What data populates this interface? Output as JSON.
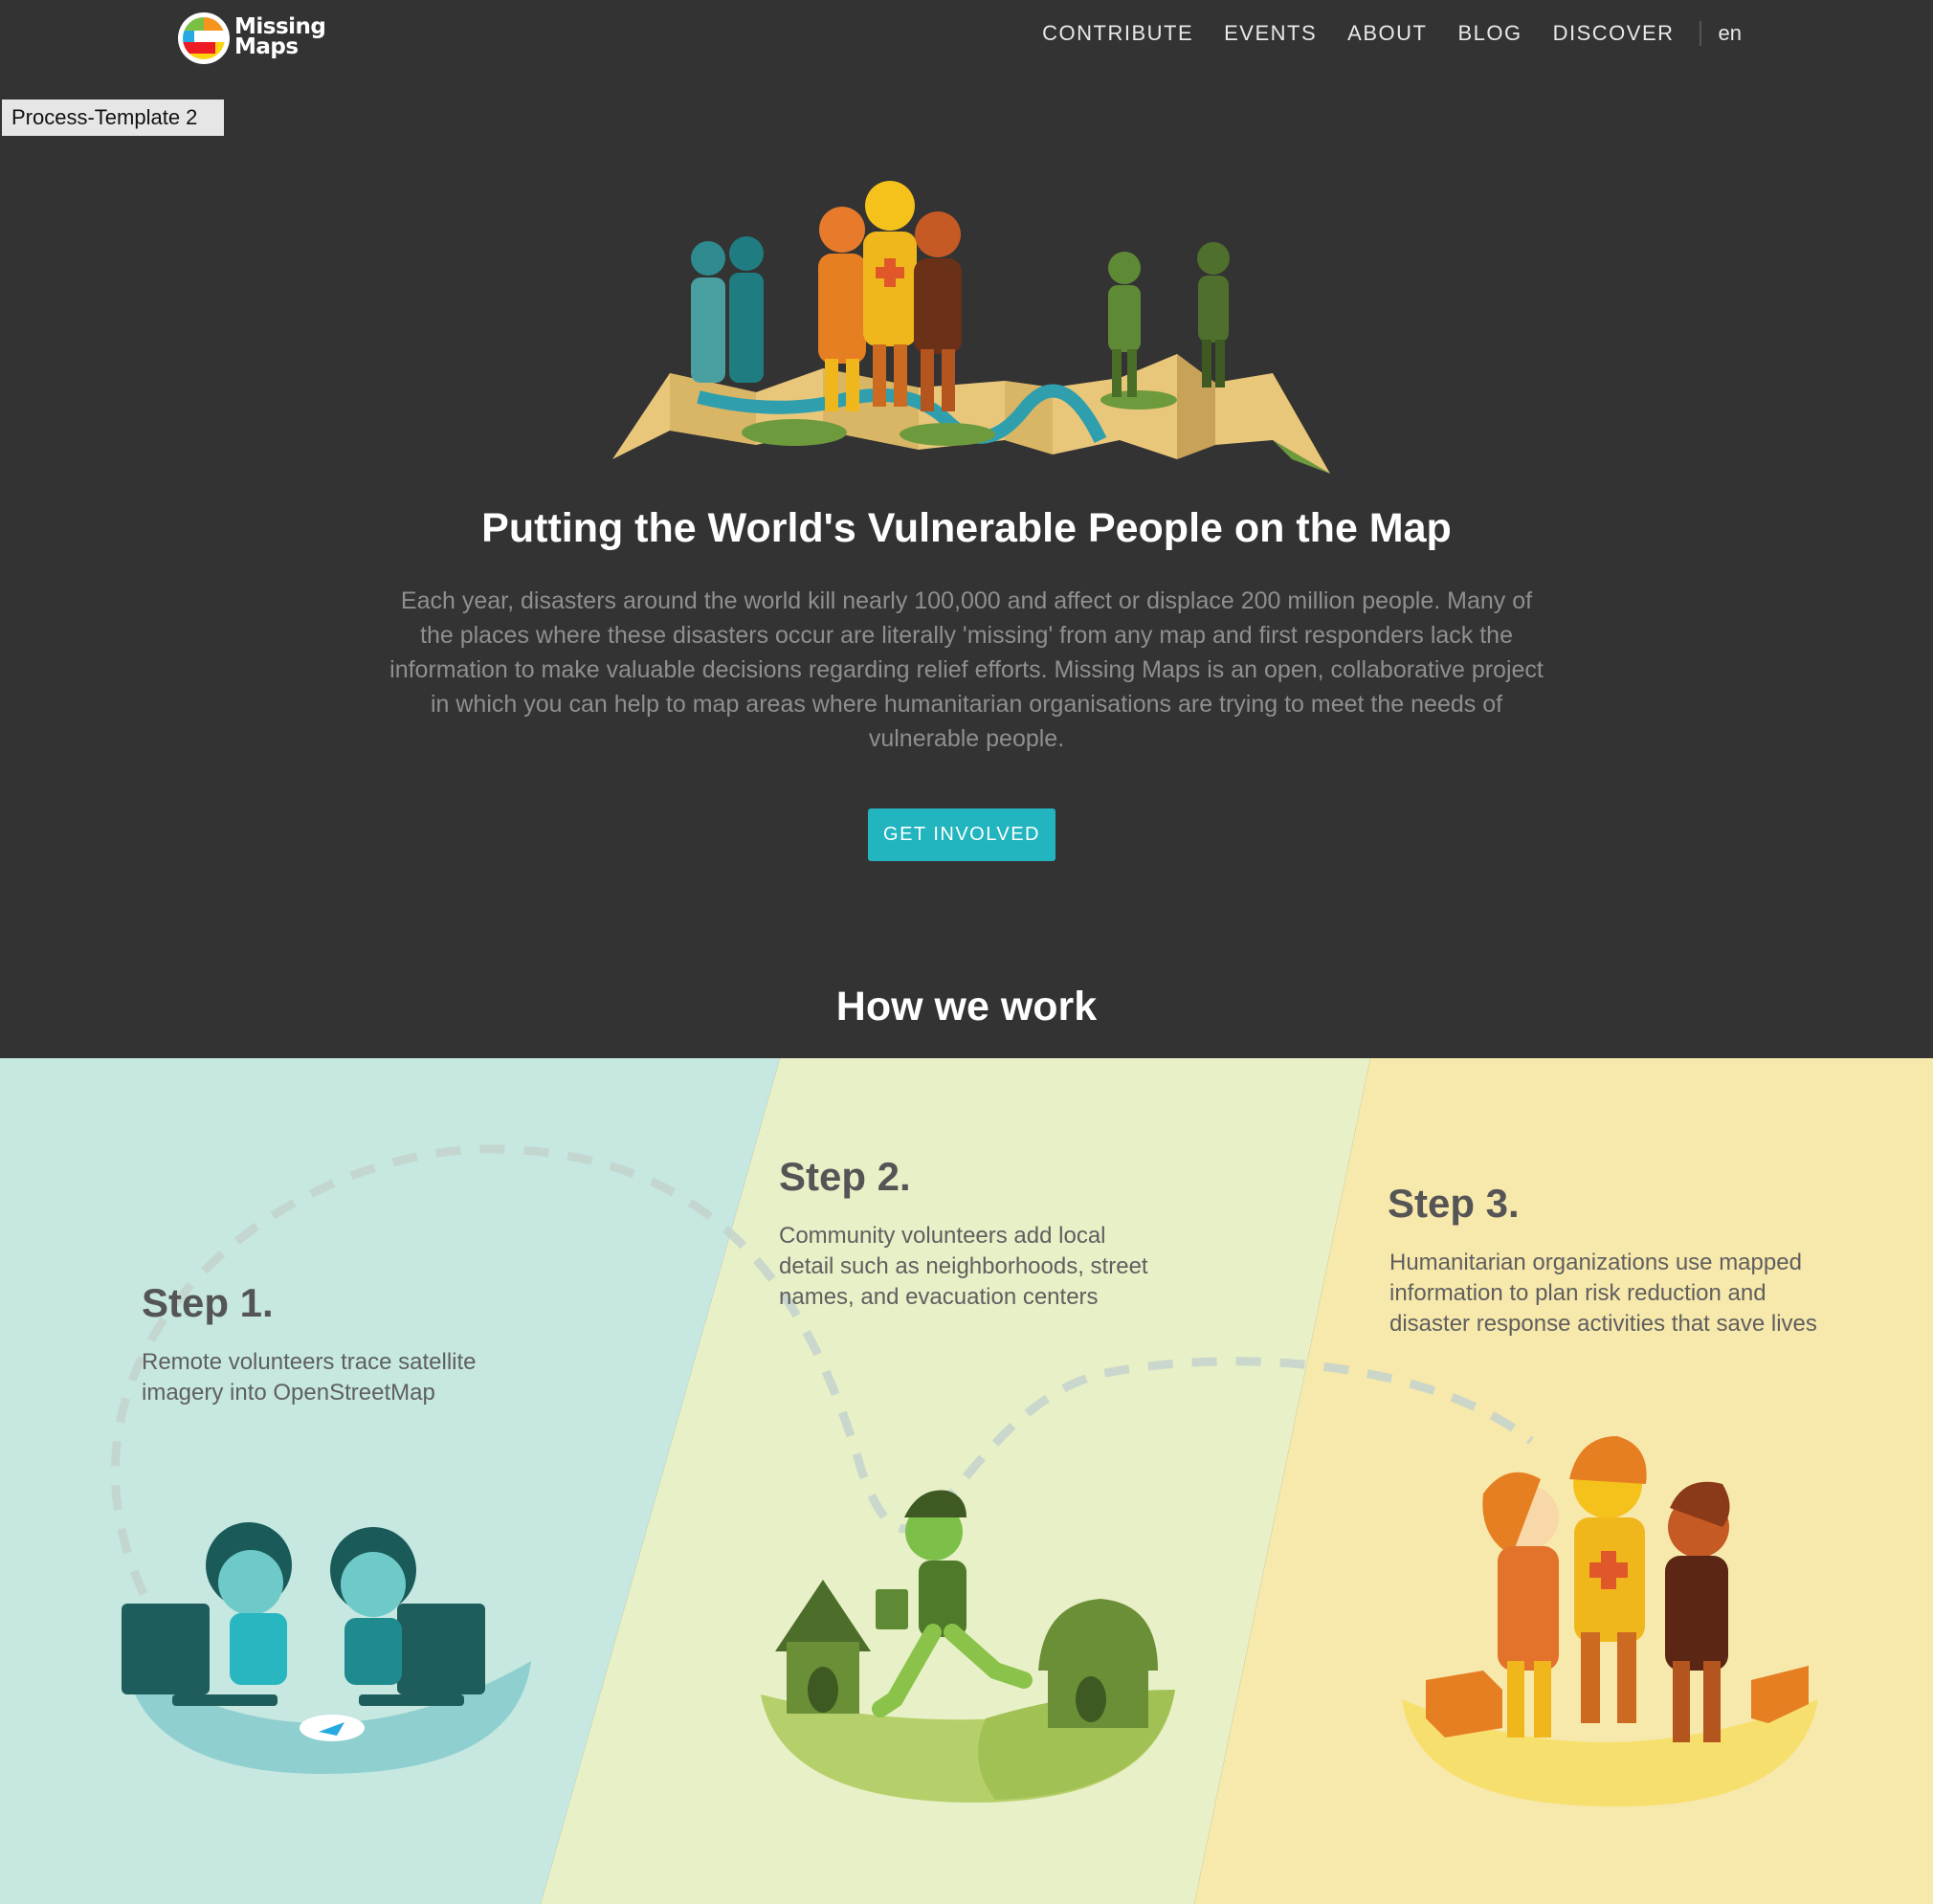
{
  "logo": {
    "line1": "Missing",
    "line2": "Maps"
  },
  "nav": {
    "items": [
      {
        "label": "CONTRIBUTE"
      },
      {
        "label": "EVENTS"
      },
      {
        "label": "ABOUT"
      },
      {
        "label": "BLOG"
      },
      {
        "label": "DISCOVER"
      }
    ],
    "language": "en"
  },
  "overlay_badge": "Process-Template 2",
  "hero": {
    "title": "Putting the World's Vulnerable People on the Map",
    "description": "Each year, disasters around the world kill nearly 100,000 and affect or displace 200 million people. Many of the places where these disasters occur are literally 'missing' from any map and first responders lack the information to make valuable decisions regarding relief efforts. Missing Maps is an open, collaborative project in which you can help to map areas where humanitarian organisations are trying to meet the needs of vulnerable people.",
    "cta_label": "GET INVOLVED"
  },
  "how": {
    "title": "How we work",
    "steps": [
      {
        "heading": "Step 1.",
        "text_line1": "Remote volunteers trace satellite",
        "text_line2": "imagery into OpenStreetMap"
      },
      {
        "heading": "Step 2.",
        "text_line1": "Community volunteers add local",
        "text_line2": "detail such as neighborhoods, street",
        "text_line3": "names, and evacuation centers"
      },
      {
        "heading": "Step 3.",
        "text_line1": "Humanitarian organizations use mapped",
        "text_line2": "information to plan risk reduction and",
        "text_line3": "disaster response activities that save lives"
      }
    ]
  },
  "colors": {
    "background_dark": "#333333",
    "accent_teal": "#22b5bf",
    "panel_step1": "#c6e8e1",
    "panel_step2": "#e8f0c7",
    "panel_step3": "#f7e8ab"
  }
}
